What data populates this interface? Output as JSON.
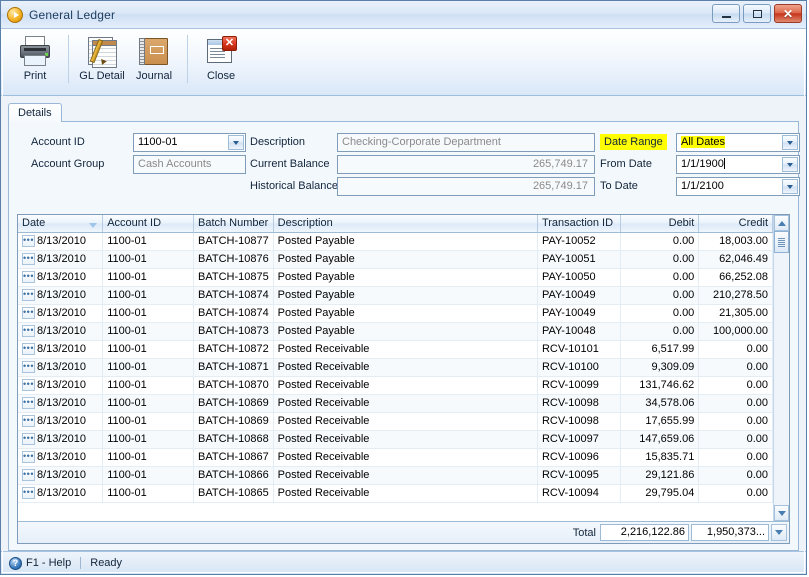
{
  "window": {
    "title": "General Ledger",
    "icon": "play-circle-icon",
    "buttons": {
      "minimize": "minimize-icon",
      "maximize": "maximize-icon",
      "close": "✕"
    }
  },
  "toolbar": {
    "items": [
      {
        "label": "Print",
        "icon": "printer-icon"
      },
      {
        "label": "GL Detail",
        "icon": "ledger-pencil-icon"
      },
      {
        "label": "Journal",
        "icon": "book-icon"
      },
      {
        "label": "Close",
        "icon": "window-close-icon"
      }
    ]
  },
  "tabs": [
    {
      "label": "Details",
      "active": true
    }
  ],
  "form": {
    "account_id": {
      "label": "Account ID",
      "value": "1100-01"
    },
    "account_group": {
      "label": "Account Group",
      "value": "Cash Accounts"
    },
    "description": {
      "label": "Description",
      "value": "Checking-Corporate Department"
    },
    "current_balance": {
      "label": "Current Balance",
      "value": "265,749.17"
    },
    "historical_balance": {
      "label": "Historical Balance",
      "value": "265,749.17"
    },
    "date_range": {
      "label": "Date Range",
      "value": "All Dates",
      "highlight_color": "#ffff00"
    },
    "from_date": {
      "label": "From Date",
      "value": "1/1/1900"
    },
    "to_date": {
      "label": "To Date",
      "value": "1/1/2100"
    }
  },
  "grid": {
    "columns": [
      {
        "key": "date",
        "label": "Date",
        "sorted": "desc"
      },
      {
        "key": "account_id",
        "label": "Account ID"
      },
      {
        "key": "batch_number",
        "label": "Batch Number"
      },
      {
        "key": "description",
        "label": "Description"
      },
      {
        "key": "transaction_id",
        "label": "Transaction ID"
      },
      {
        "key": "debit",
        "label": "Debit",
        "align": "right"
      },
      {
        "key": "credit",
        "label": "Credit",
        "align": "right"
      }
    ],
    "rows": [
      {
        "date": "8/13/2010",
        "account_id": "1100-01",
        "batch_number": "BATCH-10877",
        "description": "Posted Payable",
        "transaction_id": "PAY-10052",
        "debit": "0.00",
        "credit": "18,003.00"
      },
      {
        "date": "8/13/2010",
        "account_id": "1100-01",
        "batch_number": "BATCH-10876",
        "description": "Posted Payable",
        "transaction_id": "PAY-10051",
        "debit": "0.00",
        "credit": "62,046.49"
      },
      {
        "date": "8/13/2010",
        "account_id": "1100-01",
        "batch_number": "BATCH-10875",
        "description": "Posted Payable",
        "transaction_id": "PAY-10050",
        "debit": "0.00",
        "credit": "66,252.08"
      },
      {
        "date": "8/13/2010",
        "account_id": "1100-01",
        "batch_number": "BATCH-10874",
        "description": "Posted Payable",
        "transaction_id": "PAY-10049",
        "debit": "0.00",
        "credit": "210,278.50"
      },
      {
        "date": "8/13/2010",
        "account_id": "1100-01",
        "batch_number": "BATCH-10874",
        "description": "Posted Payable",
        "transaction_id": "PAY-10049",
        "debit": "0.00",
        "credit": "21,305.00"
      },
      {
        "date": "8/13/2010",
        "account_id": "1100-01",
        "batch_number": "BATCH-10873",
        "description": "Posted Payable",
        "transaction_id": "PAY-10048",
        "debit": "0.00",
        "credit": "100,000.00"
      },
      {
        "date": "8/13/2010",
        "account_id": "1100-01",
        "batch_number": "BATCH-10872",
        "description": "Posted Receivable",
        "transaction_id": "RCV-10101",
        "debit": "6,517.99",
        "credit": "0.00"
      },
      {
        "date": "8/13/2010",
        "account_id": "1100-01",
        "batch_number": "BATCH-10871",
        "description": "Posted Receivable",
        "transaction_id": "RCV-10100",
        "debit": "9,309.09",
        "credit": "0.00"
      },
      {
        "date": "8/13/2010",
        "account_id": "1100-01",
        "batch_number": "BATCH-10870",
        "description": "Posted Receivable",
        "transaction_id": "RCV-10099",
        "debit": "131,746.62",
        "credit": "0.00"
      },
      {
        "date": "8/13/2010",
        "account_id": "1100-01",
        "batch_number": "BATCH-10869",
        "description": "Posted Receivable",
        "transaction_id": "RCV-10098",
        "debit": "34,578.06",
        "credit": "0.00"
      },
      {
        "date": "8/13/2010",
        "account_id": "1100-01",
        "batch_number": "BATCH-10869",
        "description": "Posted Receivable",
        "transaction_id": "RCV-10098",
        "debit": "17,655.99",
        "credit": "0.00"
      },
      {
        "date": "8/13/2010",
        "account_id": "1100-01",
        "batch_number": "BATCH-10868",
        "description": "Posted Receivable",
        "transaction_id": "RCV-10097",
        "debit": "147,659.06",
        "credit": "0.00"
      },
      {
        "date": "8/13/2010",
        "account_id": "1100-01",
        "batch_number": "BATCH-10867",
        "description": "Posted Receivable",
        "transaction_id": "RCV-10096",
        "debit": "15,835.71",
        "credit": "0.00"
      },
      {
        "date": "8/13/2010",
        "account_id": "1100-01",
        "batch_number": "BATCH-10866",
        "description": "Posted Receivable",
        "transaction_id": "RCV-10095",
        "debit": "29,121.86",
        "credit": "0.00"
      },
      {
        "date": "8/13/2010",
        "account_id": "1100-01",
        "batch_number": "BATCH-10865",
        "description": "Posted Receivable",
        "transaction_id": "RCV-10094",
        "debit": "29,795.04",
        "credit": "0.00"
      }
    ],
    "total": {
      "label": "Total",
      "debit": "2,216,122.86",
      "credit": "1,950,373..."
    }
  },
  "statusbar": {
    "help": "F1 - Help",
    "state": "Ready"
  }
}
